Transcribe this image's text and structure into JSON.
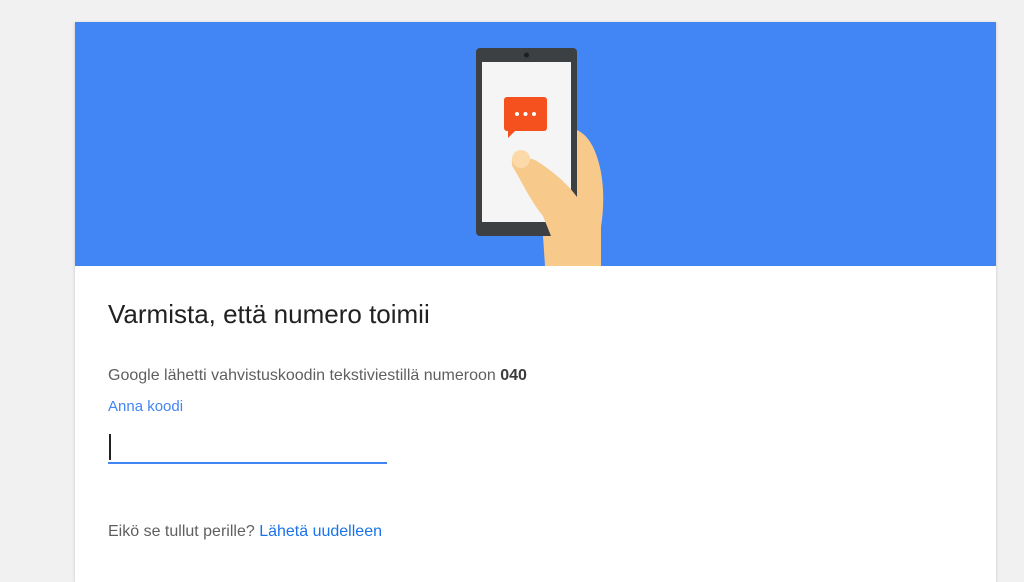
{
  "verify": {
    "title": "Varmista, että numero toimii",
    "description_prefix": "Google lähetti vahvistuskoodin tekstiviestillä numeroon",
    "phone_number": "040",
    "code_label": "Anna koodi",
    "code_value": "",
    "resend_prompt": "Eikö se tullut perille?",
    "resend_link": "Lähetä uudelleen"
  },
  "colors": {
    "banner": "#4285f4",
    "accent": "#4285f4",
    "message_bubble": "#f4511e"
  },
  "icons": {
    "illustration": "phone-in-hand-illustration",
    "bubble": "sms-bubble-icon"
  }
}
